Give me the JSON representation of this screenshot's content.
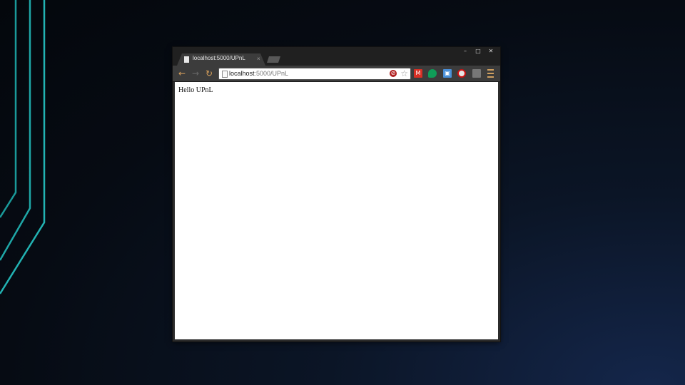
{
  "browser": {
    "tab": {
      "title": "localhost:5000/UPnL",
      "close_glyph": "×"
    },
    "window_controls": {
      "minimize": "–",
      "maximize": "□",
      "close": "✕"
    },
    "nav": {
      "back_icon": "arrow-left-icon",
      "forward_icon": "arrow-right-icon",
      "reload_icon": "reload-icon",
      "back_glyph": "←",
      "forward_glyph": "→",
      "reload_glyph": "↻"
    },
    "address_bar": {
      "host": "localhost",
      "rest": ":5000/UPnL"
    },
    "extensions": [
      {
        "name": "gmail-icon",
        "glyph": "M",
        "color": "#d93025"
      },
      {
        "name": "hangouts-icon",
        "glyph": "",
        "color": "#0f9d58"
      },
      {
        "name": "photos-icon",
        "glyph": "▣",
        "color": "#4a90d9"
      },
      {
        "name": "opera-icon",
        "glyph": "",
        "color": "#cc1111"
      },
      {
        "name": "devtools-icon",
        "glyph": "",
        "color": "#777777"
      }
    ],
    "menu_icon": "menu-icon"
  },
  "page": {
    "body_text": "Hello UPnL"
  },
  "colors": {
    "background": "#060b13",
    "accent_lines": "#1fa7a7",
    "chrome_dark": "#202020",
    "toolbar": "#3c3c3c"
  }
}
